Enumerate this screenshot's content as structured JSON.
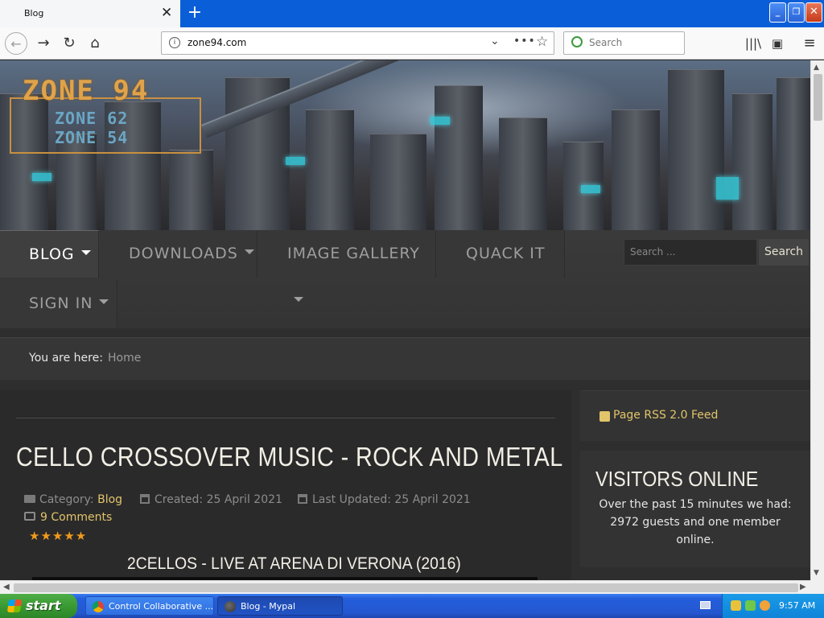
{
  "browser": {
    "tab_title": "Blog",
    "tab_close": "✕",
    "new_tab": "+",
    "url": "zone94.com",
    "search_placeholder": "Search",
    "window_controls": {
      "minimize": "_",
      "maximize": "❐",
      "close": "✕"
    }
  },
  "site": {
    "logo_main": "ZONE 94",
    "logo_sub1": "ZONE 62",
    "logo_sub2": "ZONE 54",
    "menu": {
      "items": [
        {
          "label": "BLOG",
          "dropdown": true,
          "active": true
        },
        {
          "label": "DOWNLOADS",
          "dropdown": true
        },
        {
          "label": "IMAGE GALLERY",
          "dropdown": true
        },
        {
          "label": "QUACK IT",
          "dropdown": false
        },
        {
          "label": "SIGN IN",
          "dropdown": true
        }
      ],
      "search_placeholder": "Search ...",
      "search_button": "Search"
    },
    "breadcrumb": {
      "label": "You are here:",
      "home": "Home"
    },
    "article": {
      "title": "CELLO CROSSOVER MUSIC - ROCK AND METAL",
      "category_label": "Category:",
      "category": "Blog",
      "created": "Created: 25 April 2021",
      "updated": "Last Updated: 25 April 2021",
      "comments": "9 Comments",
      "rating_stars": "★★★★★",
      "rating_value": 5,
      "video_title": "2CELLOS - LIVE AT ARENA DI VERONA (2016)"
    },
    "sidebar": {
      "rss": "Page RSS 2.0 Feed",
      "visitors_title": "VISITORS ONLINE",
      "visitors_text": "Over the past 15 minutes we had: 2972 guests and one member online."
    }
  },
  "taskbar": {
    "start": "start",
    "tasks": [
      {
        "label": "Control Collaborative ..."
      },
      {
        "label": "Blog - Mypal"
      }
    ],
    "clock": "9:57 AM"
  },
  "colors": {
    "accent_gold": "#e2c46a",
    "rating_orange": "#ef9a1e",
    "xp_blue": "#245edb",
    "xp_green": "#3a9a33"
  }
}
